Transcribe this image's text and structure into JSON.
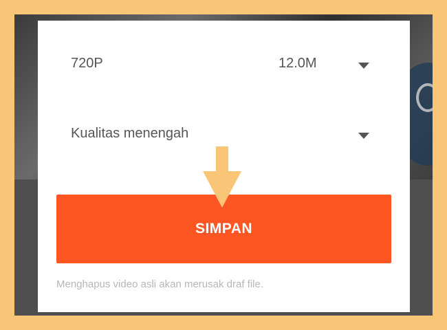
{
  "export_dialog": {
    "resolution": "720P",
    "file_size": "12.0M",
    "quality": "Kualitas menengah",
    "save_label": "SIMPAN",
    "warning": "Menghapus video asli akan merusak draf file."
  },
  "colors": {
    "frame": "#f8c676",
    "save_button": "#fe5622",
    "arrow": "#f8c676"
  },
  "icons": {
    "resolution_dropdown": "caret-down-icon",
    "quality_dropdown": "caret-down-icon",
    "annotation": "down-arrow-icon"
  }
}
